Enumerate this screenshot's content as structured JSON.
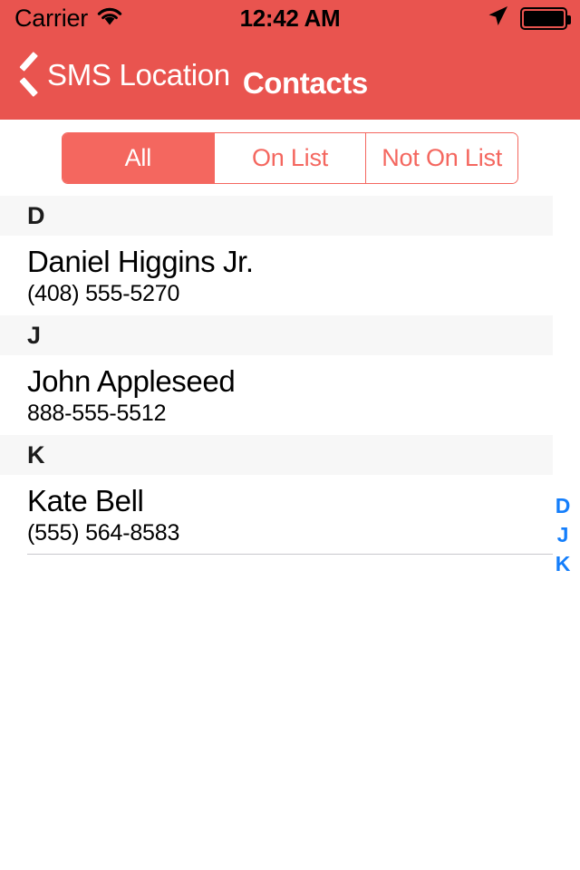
{
  "status_bar": {
    "carrier": "Carrier",
    "wifi_icon": "wifi-icon",
    "time": "12:42 AM",
    "location_icon": "location-arrow-icon",
    "battery_icon": "battery-full-icon"
  },
  "nav_bar": {
    "back_icon": "chevron-left-icon",
    "back_label": "SMS Location",
    "title": "Contacts",
    "background_color": "#E9544F",
    "text_color": "#FFFFFF"
  },
  "segmented_control": {
    "segments": [
      {
        "label": "All",
        "selected": true
      },
      {
        "label": "On List",
        "selected": false
      },
      {
        "label": "Not On List",
        "selected": false
      }
    ],
    "accent_color": "#F4675F"
  },
  "contact_list": {
    "sections": [
      {
        "letter": "D",
        "contacts": [
          {
            "name": "Daniel Higgins Jr.",
            "phone": "(408) 555-5270"
          }
        ]
      },
      {
        "letter": "J",
        "contacts": [
          {
            "name": "John Appleseed",
            "phone": "888-555-5512"
          }
        ]
      },
      {
        "letter": "K",
        "contacts": [
          {
            "name": "Kate Bell",
            "phone": "(555) 564-8583"
          }
        ]
      }
    ]
  },
  "section_index": {
    "letters": [
      "D",
      "J",
      "K"
    ],
    "color": "#147EFB"
  }
}
